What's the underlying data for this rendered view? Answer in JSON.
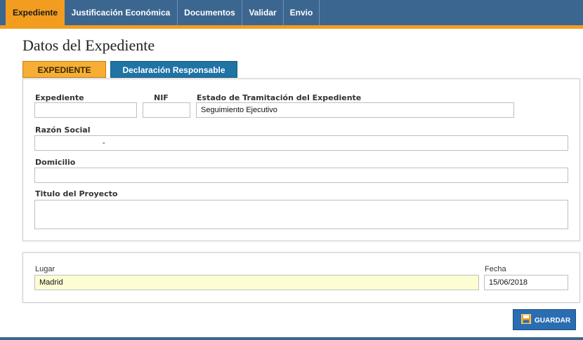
{
  "nav": {
    "tabs": [
      {
        "label": "Expediente",
        "active": true
      },
      {
        "label": "Justificación Económica"
      },
      {
        "label": "Documentos"
      },
      {
        "label": "Validar"
      },
      {
        "label": "Envio"
      }
    ]
  },
  "page": {
    "title": "Datos del Expediente"
  },
  "subtabs": [
    {
      "label": "EXPEDIENTE",
      "selected": true
    },
    {
      "label": "Declaración Responsable"
    }
  ],
  "form": {
    "expediente": {
      "label": "Expediente",
      "value": ""
    },
    "nif": {
      "label": "NIF",
      "value": ""
    },
    "estado": {
      "label": "Estado de Tramitación del Expediente",
      "value": "Seguimiento Ejecutivo"
    },
    "razon_social": {
      "label": "Razón Social",
      "value": "-"
    },
    "domicilio": {
      "label": "Domicilio",
      "value": ""
    },
    "titulo": {
      "label": "Titulo del Proyecto",
      "value": ""
    }
  },
  "lugar": {
    "label": "Lugar",
    "value": "Madrid"
  },
  "fecha": {
    "label": "Fecha",
    "value": "15/06/2018"
  },
  "actions": {
    "guardar_label": "GUARDAR"
  },
  "colors": {
    "nav_bg": "#3b6690",
    "accent_orange": "#f29d1f",
    "subtab_blue": "#1f73a5",
    "button_blue": "#2a6db0",
    "highlight_yellow": "#fdfdd4"
  }
}
